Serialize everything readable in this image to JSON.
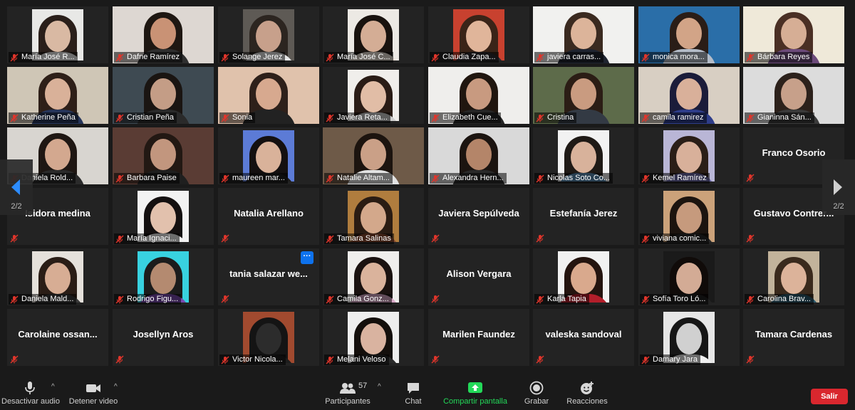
{
  "participants_grid": [
    {
      "name": "María José R...",
      "kind": "video",
      "wall": "#e8e8e6",
      "hair": "#2a1f1a",
      "skin": "#d9b9a3",
      "shirt": "#f2f2f2",
      "photo": true
    },
    {
      "name": "Dafne Ramírez",
      "kind": "video",
      "wall": "#ddd7d2",
      "hair": "#1e1712",
      "skin": "#c99275",
      "shirt": "#2f2f2f"
    },
    {
      "name": "Solange Jerez",
      "kind": "video",
      "wall": "#5e5a55",
      "hair": "#2c2520",
      "skin": "#c7a08b",
      "shirt": "#e6e6e6",
      "photo": true
    },
    {
      "name": "María José C...",
      "kind": "video",
      "wall": "#ece9e4",
      "hair": "#18120e",
      "skin": "#d4ad95",
      "shirt": "#e9dfd6",
      "photo": true
    },
    {
      "name": "Claudia Zapa...",
      "kind": "video",
      "wall": "#c8412f",
      "hair": "#3a2418",
      "skin": "#e0b59a",
      "shirt": "#2d2b2f",
      "photo": true
    },
    {
      "name": "javiera carras...",
      "kind": "video",
      "wall": "#f1f1ef",
      "hair": "#3a2a20",
      "skin": "#dcb49a",
      "shirt": "#1f2430"
    },
    {
      "name": "monica mora...",
      "kind": "video",
      "wall": "#2a6ea8",
      "hair": "#2a1d17",
      "skin": "#d2a487",
      "shirt": "#b4bcc8"
    },
    {
      "name": "Bárbara Reyes",
      "kind": "video",
      "wall": "#efe9d9",
      "hair": "#4a2f24",
      "skin": "#d6ae95",
      "shirt": "#6c4a7a"
    },
    {
      "name": "Katherine Peña",
      "kind": "video",
      "wall": "#cfc6b6",
      "hair": "#2e1f18",
      "skin": "#d9b199",
      "shirt": "#26355a"
    },
    {
      "name": "Cristian Peña",
      "kind": "video",
      "wall": "#3e4a52",
      "hair": "#1a1512",
      "skin": "#c49d86",
      "shirt": "#2a2a2a"
    },
    {
      "name": "Sonia",
      "kind": "video",
      "wall": "#e0c2ac",
      "hair": "#2e201a",
      "skin": "#d7a98f",
      "shirt": "#222222"
    },
    {
      "name": "Javiera Reta...",
      "kind": "video",
      "wall": "#f0eeeb",
      "hair": "#2a1c16",
      "skin": "#e1bda6",
      "shirt": "#cfcfcf",
      "photo": true
    },
    {
      "name": "Elizabeth Cue...",
      "kind": "video",
      "wall": "#efeeec",
      "hair": "#20160f",
      "skin": "#c89a80",
      "shirt": "#262626"
    },
    {
      "name": "Cristina",
      "kind": "video",
      "wall": "#5d6b4a",
      "hair": "#2b1d15",
      "skin": "#c99b80",
      "shirt": "#333a44"
    },
    {
      "name": "camila ramirez",
      "kind": "video",
      "wall": "#d8cfc3",
      "hair": "#1b1c3a",
      "skin": "#d9b09a",
      "shirt": "#2e3d8a"
    },
    {
      "name": "Gianinna Sán...",
      "kind": "video",
      "wall": "#dcdcdc",
      "hair": "#2c211b",
      "skin": "#c7a08a",
      "shirt": "#3a3a3a"
    },
    {
      "name": "Daniela Rold...",
      "kind": "video",
      "wall": "#d8d5d0",
      "hair": "#1f1713",
      "skin": "#d3a88f",
      "shirt": "#2b2b2b"
    },
    {
      "name": "Barbara Paise",
      "kind": "video",
      "wall": "#5a3c34",
      "hair": "#221813",
      "skin": "#c2967e",
      "shirt": "#1f1f1f"
    },
    {
      "name": "maureen mar...",
      "kind": "video",
      "wall": "#5c7bd6",
      "hair": "#141010",
      "skin": "#d9b29a",
      "shirt": "#1d1d1d",
      "photo": true
    },
    {
      "name": "Natalie Altam...",
      "kind": "video",
      "wall": "#6e5a48",
      "hair": "#1c140f",
      "skin": "#caa087",
      "shirt": "#e2e2e2"
    },
    {
      "name": "Alexandra Hern...",
      "kind": "video",
      "wall": "#d9d9d9",
      "hair": "#1b1410",
      "skin": "#b48569",
      "shirt": "#2a2a2a"
    },
    {
      "name": "Nicolas Soto Co...",
      "kind": "video",
      "wall": "#f2f2f2",
      "hair": "#1f1a16",
      "skin": "#d8b29b",
      "shirt": "#5b8fb7",
      "photo": true
    },
    {
      "name": "Kemel Ramírez",
      "kind": "video",
      "wall": "#b9b6d6",
      "hair": "#2a1e17",
      "skin": "#d8b09a",
      "shirt": "#6d6aa8",
      "photo": true
    },
    {
      "name": "Franco Osorio",
      "kind": "name"
    },
    {
      "name": "Isidora medina",
      "kind": "name"
    },
    {
      "name": "María Ignaci...",
      "kind": "video",
      "wall": "#f2f2f2",
      "hair": "#141010",
      "skin": "#e2c1ad",
      "shirt": "#f2f2f2",
      "photo": true
    },
    {
      "name": "Natalia Arellano",
      "kind": "name"
    },
    {
      "name": "Tamara Salinas",
      "kind": "video",
      "wall": "#b07d3e",
      "hair": "#2a1c13",
      "skin": "#d3a88b",
      "shirt": "#8a4b2f",
      "photo": true
    },
    {
      "name": "Javiera Sepúlveda",
      "kind": "name"
    },
    {
      "name": "Estefanía Jerez",
      "kind": "name"
    },
    {
      "name": "viviana comic...",
      "kind": "video",
      "wall": "#cba27a",
      "hair": "#1c140f",
      "skin": "#c69a7d",
      "shirt": "#2a2a2a",
      "photo": true
    },
    {
      "name": "Gustavo  Contrer...",
      "kind": "name"
    },
    {
      "name": "Daniela Mald...",
      "kind": "video",
      "wall": "#e5e1db",
      "hair": "#2a1d16",
      "skin": "#d7ad94",
      "shirt": "#3b3b3b",
      "photo": true
    },
    {
      "name": "Rodrigo Figu...",
      "kind": "video",
      "wall": "#38d2e0",
      "hair": "#1c1c1c",
      "skin": "#b48a70",
      "shirt": "#7a4ab0",
      "photo": true
    },
    {
      "name": "tania  salazar  we...",
      "kind": "name",
      "more": true
    },
    {
      "name": "Camila Gonz...",
      "kind": "video",
      "wall": "#efeeec",
      "hair": "#1a1210",
      "skin": "#dab39c",
      "shirt": "#d9a9c8",
      "photo": true
    },
    {
      "name": "Alison Vergara",
      "kind": "name"
    },
    {
      "name": "Karla Tapia",
      "kind": "video",
      "wall": "#f1f1f1",
      "hair": "#24140f",
      "skin": "#d9a98d",
      "shirt": "#b31e2a",
      "photo": true
    },
    {
      "name": "Sofía Toro Ló...",
      "kind": "video",
      "wall": "#1a1a1a",
      "hair": "#100b09",
      "skin": "#d3ab95",
      "shirt": "#222222",
      "photo": true
    },
    {
      "name": "Carolina Brav...",
      "kind": "video",
      "wall": "#c2b39b",
      "hair": "#3a2a1d",
      "skin": "#dcb39a",
      "shirt": "#2c5a6e",
      "photo": true
    },
    {
      "name": "Carolaine  ossan...",
      "kind": "name"
    },
    {
      "name": "Josellyn Aros",
      "kind": "name"
    },
    {
      "name": "Victor Nicola...",
      "kind": "video",
      "wall": "#a14a2f",
      "hair": "#141414",
      "skin": "#2c2c2c",
      "shirt": "#1d1d1d",
      "photo": true
    },
    {
      "name": "Melani Veloso",
      "kind": "video",
      "wall": "#eeeeee",
      "hair": "#140f0c",
      "skin": "#d9b3a0",
      "shirt": "#2a2a2a",
      "photo": true
    },
    {
      "name": "Marilen Faundez",
      "kind": "name"
    },
    {
      "name": "valeska sandoval",
      "kind": "name"
    },
    {
      "name": "Damary Jara",
      "kind": "video",
      "wall": "#e6e6e6",
      "hair": "#161616",
      "skin": "#d0d0d0",
      "shirt": "#f0f0f0",
      "photo": true
    },
    {
      "name": "Tamara Cardenas",
      "kind": "name"
    }
  ],
  "pager": {
    "left_label": "2/2",
    "right_label": "2/2"
  },
  "more_options_label": "···",
  "toolbar": {
    "mute_label": "Desactivar audio",
    "video_label": "Detener video",
    "participants_label": "Participantes",
    "participants_count": "57",
    "chat_label": "Chat",
    "share_label": "Compartir pantalla",
    "record_label": "Grabar",
    "reactions_label": "Reacciones",
    "leave_label": "Salir",
    "caret": "^"
  },
  "colors": {
    "tile_bg": "#232323",
    "toolbar_bg": "#1a1a1a",
    "muted_red": "#e0352b",
    "share_green": "#23d959",
    "leave_red": "#d9272e",
    "accent_blue": "#0e72ed"
  }
}
